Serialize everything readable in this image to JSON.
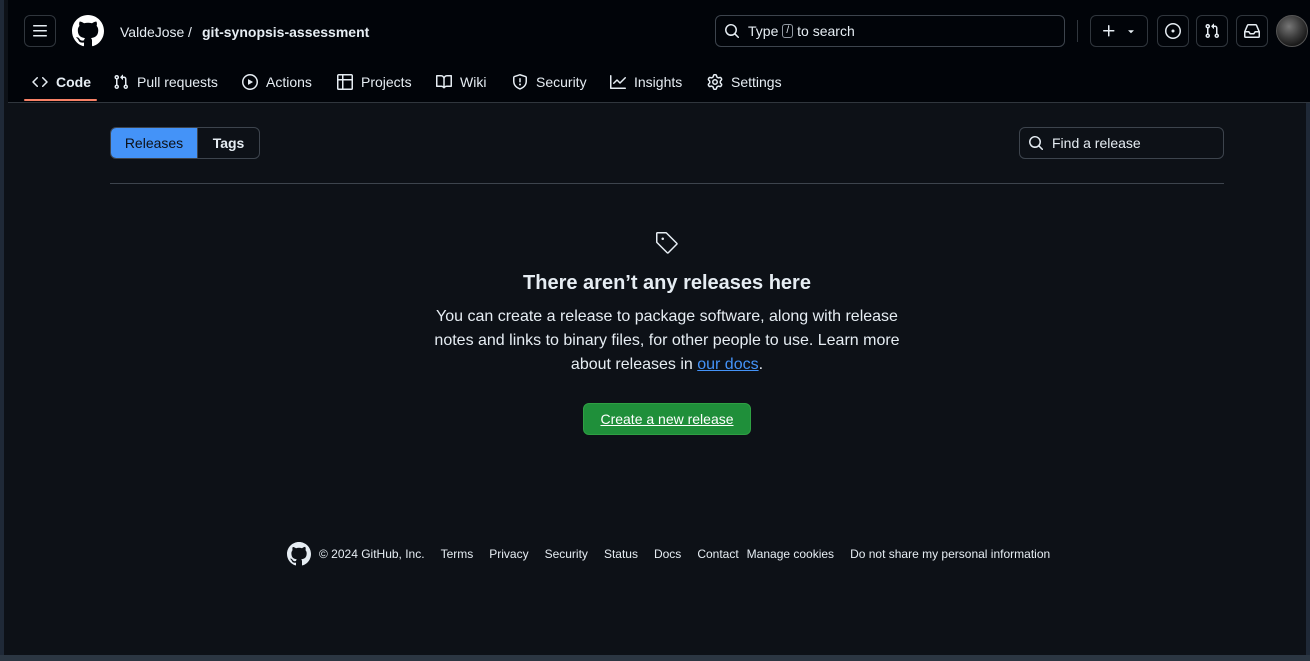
{
  "header": {
    "owner": "ValdeJose",
    "separator": "/",
    "repo": "git-synopsis-assessment",
    "search_prefix": "Type",
    "search_key": "/",
    "search_suffix": "to search"
  },
  "tabs": [
    {
      "label": "Code",
      "icon": "code-icon",
      "active": true
    },
    {
      "label": "Pull requests",
      "icon": "git-pull-request-icon"
    },
    {
      "label": "Actions",
      "icon": "play-icon"
    },
    {
      "label": "Projects",
      "icon": "table-icon"
    },
    {
      "label": "Wiki",
      "icon": "book-icon"
    },
    {
      "label": "Security",
      "icon": "shield-icon"
    },
    {
      "label": "Insights",
      "icon": "graph-icon"
    },
    {
      "label": "Settings",
      "icon": "gear-icon"
    }
  ],
  "releases": {
    "toggle_releases": "Releases",
    "toggle_tags": "Tags",
    "find_placeholder": "Find a release",
    "empty_title": "There aren’t any releases here",
    "empty_text": "You can create a release to package software, along with release notes and links to binary files, for other people to use. Learn more about releases in",
    "docs_link": "our docs",
    "period": ".",
    "create_button": "Create a new release"
  },
  "footer": {
    "copyright": "© 2024 GitHub, Inc.",
    "links": [
      "Terms",
      "Privacy",
      "Security",
      "Status",
      "Docs",
      "Contact",
      "Manage cookies",
      "Do not share my personal information"
    ]
  },
  "colors": {
    "accent_blue": "#4493f8",
    "success_green": "#238636",
    "tab_underline": "#f78166",
    "background": "#0d1117"
  }
}
